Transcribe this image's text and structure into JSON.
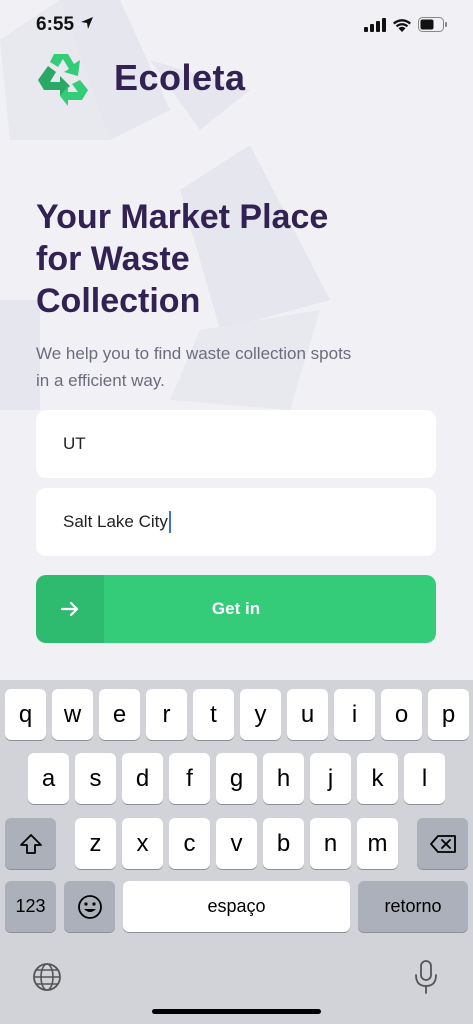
{
  "status_bar": {
    "time": "6:55"
  },
  "app": {
    "logo_text": "Ecoleta"
  },
  "hero": {
    "title": "Your Market Place for Waste Collection",
    "subtitle": "We help you to find waste collection spots in a efficient way."
  },
  "form": {
    "state_value": "UT",
    "city_value": "Salt Lake City",
    "submit_label": "Get in"
  },
  "colors": {
    "brand_purple": "#322153",
    "brand_green": "#34cb79",
    "text_gray": "#6c6c80",
    "background": "#f0f0f5"
  },
  "keyboard": {
    "row1": [
      "q",
      "w",
      "e",
      "r",
      "t",
      "y",
      "u",
      "i",
      "o",
      "p"
    ],
    "row2": [
      "a",
      "s",
      "d",
      "f",
      "g",
      "h",
      "j",
      "k",
      "l"
    ],
    "row3": [
      "z",
      "x",
      "c",
      "v",
      "b",
      "n",
      "m"
    ],
    "numbers_label": "123",
    "space_label": "espaço",
    "return_label": "retorno"
  }
}
